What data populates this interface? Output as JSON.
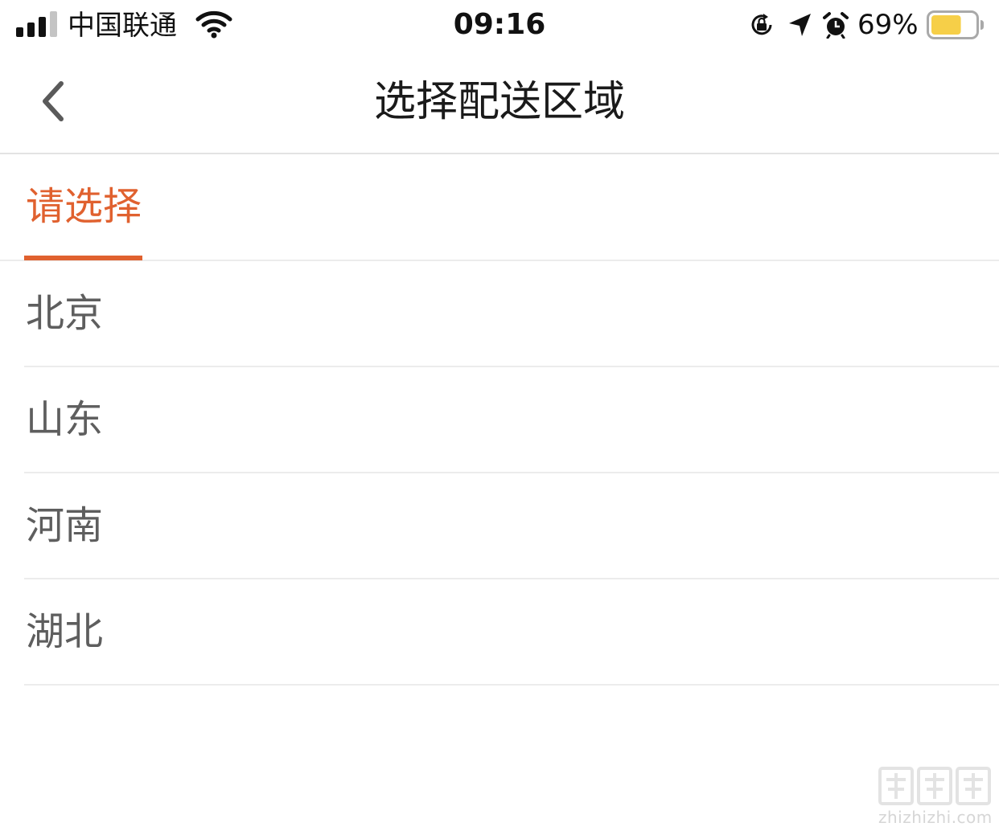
{
  "status_bar": {
    "carrier": "中国联通",
    "time": "09:16",
    "battery_percent": "69%",
    "battery_level": 0.69,
    "battery_color": "#f6cf48",
    "signal_bars_active": 3,
    "signal_bars_total": 4,
    "icons": [
      "signal-icon",
      "wifi-icon",
      "orientation-lock-icon",
      "location-arrow-icon",
      "alarm-icon",
      "battery-icon"
    ]
  },
  "nav": {
    "title": "选择配送区域",
    "back_icon": "chevron-left-icon"
  },
  "tabs": [
    {
      "label": "请选择",
      "active": true
    }
  ],
  "regions": [
    {
      "label": "北京"
    },
    {
      "label": "山东"
    },
    {
      "label": "河南"
    },
    {
      "label": "湖北"
    }
  ],
  "watermark": {
    "text": "zhizhizhi.com",
    "logo": "值值值"
  },
  "colors": {
    "accent": "#e0612f",
    "item_text": "#5e5e5e",
    "title_text": "#1a1a1a",
    "divider": "#ececec"
  }
}
